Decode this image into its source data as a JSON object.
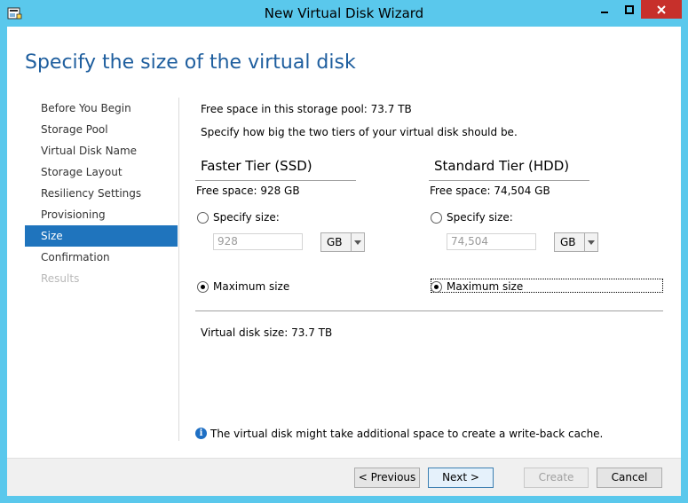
{
  "window": {
    "title": "New Virtual Disk Wizard",
    "colors": {
      "frame": "#5ac8ec",
      "close": "#c7302b",
      "accent": "#1f74bd",
      "header": "#1e5e9e"
    }
  },
  "header": {
    "title": "Specify the size of the virtual disk"
  },
  "nav": {
    "items": [
      {
        "label": "Before You Begin",
        "state": "normal"
      },
      {
        "label": "Storage Pool",
        "state": "normal"
      },
      {
        "label": "Virtual Disk Name",
        "state": "normal"
      },
      {
        "label": "Storage Layout",
        "state": "normal"
      },
      {
        "label": "Resiliency Settings",
        "state": "normal"
      },
      {
        "label": "Provisioning",
        "state": "normal"
      },
      {
        "label": "Size",
        "state": "selected"
      },
      {
        "label": "Confirmation",
        "state": "normal"
      },
      {
        "label": "Results",
        "state": "disabled"
      }
    ]
  },
  "main": {
    "free_space_pool": "Free space in this storage pool: 73.7 TB",
    "instruction": "Specify how big the two tiers of your virtual disk should be.",
    "faster_tier": {
      "heading": "Faster Tier (SSD)",
      "free_space": "Free space: 928 GB",
      "specify_label": "Specify size:",
      "size_value": "928",
      "unit": "GB",
      "maximum_label": "Maximum size",
      "selected": "maximum"
    },
    "standard_tier": {
      "heading": "Standard Tier (HDD)",
      "free_space": "Free space: 74,504 GB",
      "specify_label": "Specify size:",
      "size_value": "74,504",
      "unit": "GB",
      "maximum_label": "Maximum size",
      "selected": "maximum"
    },
    "virtual_disk_size": "Virtual disk size: 73.7 TB",
    "info_note": "The virtual disk might take additional space to create a write-back cache."
  },
  "footer": {
    "previous": "< Previous",
    "next": "Next >",
    "create": "Create",
    "cancel": "Cancel"
  }
}
